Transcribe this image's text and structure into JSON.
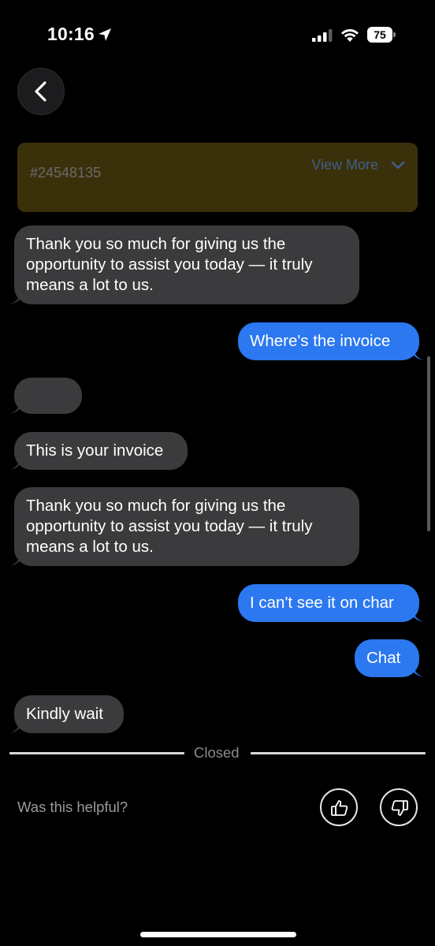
{
  "status_bar": {
    "time": "10:16",
    "battery": "75"
  },
  "ticket": {
    "id": "#24548135",
    "view_more": "View More"
  },
  "messages": [
    {
      "from": "agent",
      "lines": [
        "Thank you so much for giving us the",
        "opportunity to assist you today — it truly",
        "means a lot to us."
      ]
    },
    {
      "from": "user",
      "text": "Where's the invoice"
    },
    {
      "from": "agent",
      "text": ""
    },
    {
      "from": "agent",
      "text": "This is your invoice"
    },
    {
      "from": "agent",
      "lines": [
        "Thank you so much for giving us the",
        "opportunity to assist you today — it truly",
        "means a lot to us."
      ]
    },
    {
      "from": "user",
      "text": "I can't see it on char"
    },
    {
      "from": "user",
      "text": "Chat"
    },
    {
      "from": "agent",
      "text": "Kindly wait"
    }
  ],
  "closed_label": "Closed",
  "feedback": {
    "question": "Was this helpful?"
  },
  "colors": {
    "incoming_bubble": "#3b3b3d",
    "outgoing_bubble": "#2b78f0",
    "ticket_bar": "#3a300a",
    "link": "#3f5f8a"
  },
  "icons": [
    "location-arrow-icon",
    "signal-icon",
    "wifi-icon",
    "battery-icon",
    "chevron-left-icon",
    "chevron-down-icon",
    "thumbs-up-icon",
    "thumbs-down-icon"
  ]
}
